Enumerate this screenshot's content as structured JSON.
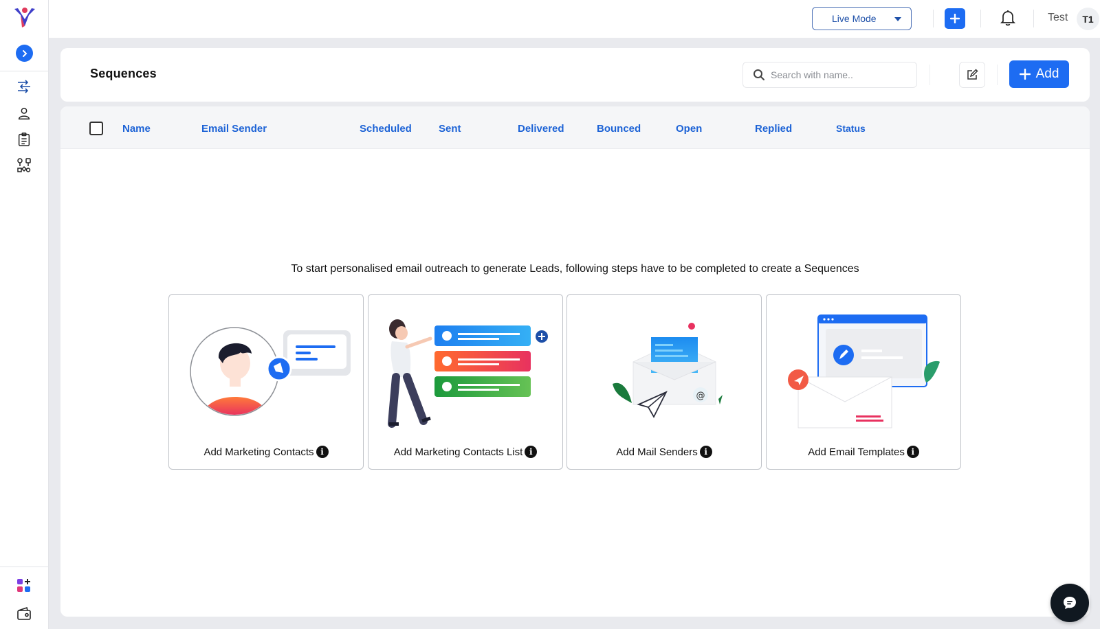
{
  "topbar": {
    "mode": "Live Mode",
    "user_name": "Test",
    "user_initials": "T1"
  },
  "header": {
    "title": "Sequences",
    "search_placeholder": "Search with name..",
    "add_label": "Add"
  },
  "table": {
    "columns": [
      "Name",
      "Email Sender",
      "Scheduled",
      "Sent",
      "Delivered",
      "Bounced",
      "Open",
      "Replied",
      "Status"
    ]
  },
  "empty_state": {
    "message": "To start personalised email outreach to generate Leads, following steps have to be completed to create a Sequences",
    "steps": [
      {
        "label": "Add Marketing Contacts"
      },
      {
        "label": "Add Marketing Contacts List"
      },
      {
        "label": "Add Mail Senders"
      },
      {
        "label": "Add Email Templates"
      }
    ]
  },
  "icons": {
    "info": "i"
  },
  "colors": {
    "accent": "#1d6cf2",
    "column_header": "#1d63d6"
  }
}
